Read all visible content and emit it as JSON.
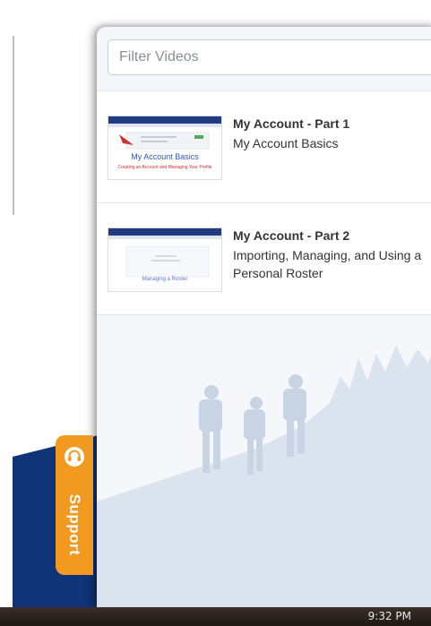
{
  "filter": {
    "placeholder": "Filter Videos"
  },
  "videos": [
    {
      "title": "My Account - Part 1",
      "description": "My Account Basics",
      "thumbnail_caption": "My Account Basics",
      "thumbnail_subcaption": "Creating an Account and Managing Your Profile"
    },
    {
      "title": "My Account - Part 2",
      "description": "Importing, Managing, and Using a Personal Roster",
      "thumbnail_caption": "Managing a Roster"
    }
  ],
  "support": {
    "label": "Support",
    "icon": "headset-icon"
  },
  "taskbar": {
    "time": "9:32 PM"
  },
  "colors": {
    "brand_navy": "#1f3b82",
    "support_orange": "#f29a1f",
    "background_navy": "#0f3477",
    "silhouette": "#dbe3ee"
  }
}
